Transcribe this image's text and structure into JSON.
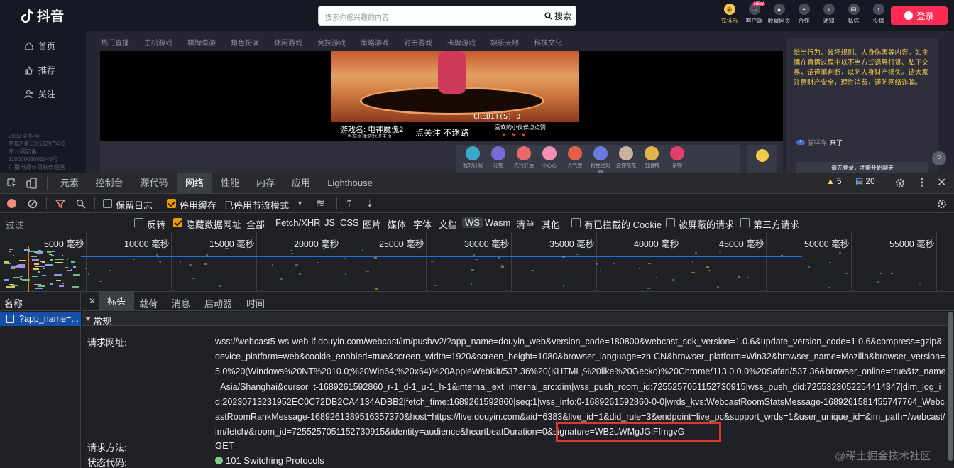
{
  "douyin": {
    "logo_text": "抖音",
    "nav": [
      "首页",
      "推荐",
      "关注"
    ],
    "legal_lines": [
      "2023 © 抖音",
      "京ICP备16016397号-3",
      "京公网安备",
      "11000002002046号",
      "广播电视节目制作经营"
    ],
    "search_placeholder": "搜索你感兴趣的内容",
    "search_button": "搜索",
    "top_icons": [
      {
        "label": "充抖币",
        "icon": "coin-icon"
      },
      {
        "label": "客户端",
        "icon": "desktop-icon",
        "badge": "NEW"
      },
      {
        "label": "收藏网页",
        "icon": "star-icon"
      },
      {
        "label": "合作",
        "icon": "handshake-icon"
      },
      {
        "label": "通知",
        "icon": "bell-icon"
      },
      {
        "label": "私信",
        "icon": "message-icon"
      },
      {
        "label": "投稿",
        "icon": "upload-icon"
      }
    ],
    "login_button": "登录",
    "categories": [
      "热门直播",
      "主机游戏",
      "棋牌桌游",
      "角色扮演",
      "休闲游戏",
      "竞技游戏",
      "策略游戏",
      "射击游戏",
      "卡牌游戏",
      "娱乐天地",
      "科技文化"
    ],
    "stream": {
      "game_name": "游戏名: 电神魔傀2",
      "game_sub": "当前直播游戏进主页",
      "follow_text": "点关注 不迷路",
      "like_text": "喜欢的小伙伴点点赞",
      "hearts": "♥♥♥",
      "credit": "CREDIT(S) 0"
    },
    "gifts": [
      "我的订阅",
      "礼物",
      "先行好运",
      "小心心",
      "人气票",
      "粉丝团灯牌",
      "送你花花",
      "加油鸭",
      "亲吻",
      "抖币"
    ],
    "chat": {
      "notice": "恰当行为、破坏规则、人身伤害等内容。如主播在直播过程中以不当方式诱导打赏、私下交易，请谨慎判断，以防人身财产损失。请大家注意财产安全，理性消费，谨防网络诈骗。",
      "user_badge": "1",
      "user_name": "猫咩咩",
      "user_action": "来了",
      "login_prompt": "请先登录，才能开始聊天"
    }
  },
  "devtools": {
    "tabs": [
      "元素",
      "控制台",
      "源代码",
      "网络",
      "性能",
      "内存",
      "应用",
      "Lighthouse"
    ],
    "active_tab": "网络",
    "warnings": "5",
    "messages": "20",
    "toolbar": {
      "preserve_log": "保留日志",
      "disable_cache": "停用缓存",
      "throttle": "已停用节流模式"
    },
    "filter": {
      "placeholder": "过滤",
      "invert": "反转",
      "hide_data_urls": "隐藏数据网址",
      "types": [
        "全部",
        "Fetch/XHR",
        "JS",
        "CSS",
        "图片",
        "媒体",
        "字体",
        "文档",
        "WS",
        "Wasm",
        "清单",
        "其他"
      ],
      "blocked_cookies": "有已拦截的 Cookie",
      "blocked_requests": "被屏蔽的请求",
      "third_party": "第三方请求"
    },
    "timeline_labels": [
      "5000 毫秒",
      "10000 毫秒",
      "15000 毫秒",
      "20000 毫秒",
      "25000 毫秒",
      "30000 毫秒",
      "35000 毫秒",
      "40000 毫秒",
      "45000 毫秒",
      "50000 毫秒",
      "55000 毫秒"
    ],
    "request_list": {
      "header": "名称",
      "item": "?app_name=..."
    },
    "detail_tabs": [
      "标头",
      "载荷",
      "消息",
      "启动器",
      "时间"
    ],
    "section": "常规",
    "general": {
      "url_key": "请求网址:",
      "url": "wss://webcast5-ws-web-lf.douyin.com/webcast/im/push/v2/?app_name=douyin_web&version_code=180800&webcast_sdk_version=1.0.6&update_version_code=1.0.6&compress=gzip&device_platform=web&cookie_enabled=true&screen_width=1920&screen_height=1080&browser_language=zh-CN&browser_platform=Win32&browser_name=Mozilla&browser_version=5.0%20(Windows%20NT%2010.0;%20Win64;%20x64)%20AppleWebKit/537.36%20(KHTML,%20like%20Gecko)%20Chrome/113.0.0.0%20Safari/537.36&browser_online=true&tz_name=Asia/Shanghai&cursor=t-1689261592860_r-1_d-1_u-1_h-1&internal_ext=internal_src:dim|wss_push_room_id:7255257051152730915|wss_push_did:7255323052254414347|dim_log_id:20230713231952EC0C72DB2CA4134ADBB2|fetch_time:1689261592860|seq:1|wss_info:0-1689261592860-0-0|wrds_kvs:WebcastRoomStatsMessage-1689261581455747764_WebcastRoomRankMessage-1689261389516357370&host=https://live.douyin.com&aid=6383&live_id=1&did_rule=3&endpoint=live_pc&support_wrds=1&user_unique_id=&im_path=/webcast/im/fetch/&room_id=7255257051152730915&identity=audience&heartbeatDuration=0&signature=WB2uWMgJGlFfmgvG",
      "method_key": "请求方法:",
      "method": "GET",
      "status_key": "状态代码:",
      "status": "101 Switching Protocols"
    },
    "watermark": "@稀土掘金技术社区"
  }
}
